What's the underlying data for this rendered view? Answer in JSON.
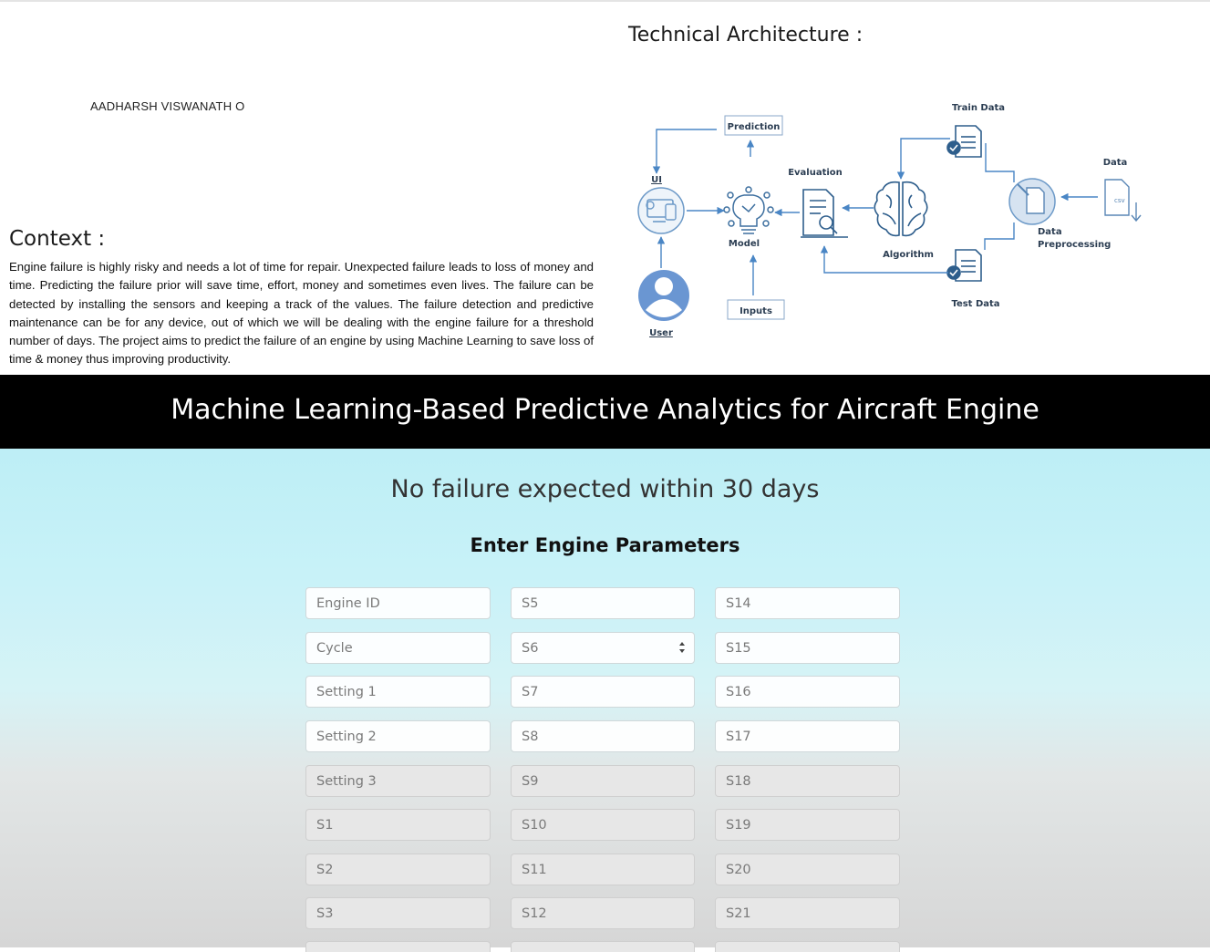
{
  "slide": {
    "author": "AADHARSH VISWANATH O",
    "context_title": "Context :",
    "context_body": "Engine failure is highly risky and needs a lot of time for repair. Unexpected failure leads to loss of money and time. Predicting the failure prior will save time, effort, money and sometimes even lives. The failure can be detected by installing the sensors and keeping a track of the values. The failure detection and predictive maintenance can be for any device, out of which we will be dealing with the engine failure for a threshold number of days. The project aims to predict the failure of an engine by using Machine Learning to save loss of time & money thus improving productivity.",
    "architecture_title": "Technical Architecture :",
    "diagram": {
      "prediction": "Prediction",
      "ui": "UI",
      "model": "Model",
      "evaluation": "Evaluation",
      "algorithm": "Algorithm",
      "train_data": "Train Data",
      "test_data": "Test Data",
      "data": "Data",
      "csv": "csv",
      "data_preprocessing_1": "Data",
      "data_preprocessing_2": "Preprocessing",
      "inputs": "Inputs",
      "user": "User"
    }
  },
  "app": {
    "header": "Machine Learning-Based Predictive Analytics for Aircraft Engine",
    "result": "No failure expected within 30 days",
    "form_title": "Enter Engine Parameters",
    "fields": [
      [
        "Engine ID",
        "S5",
        "S14"
      ],
      [
        "Cycle",
        "S6",
        "S15"
      ],
      [
        "Setting 1",
        "S7",
        "S16"
      ],
      [
        "Setting 2",
        "S8",
        "S17"
      ],
      [
        "Setting 3",
        "S9",
        "S18"
      ],
      [
        "S1",
        "S10",
        "S19"
      ],
      [
        "S2",
        "S11",
        "S20"
      ],
      [
        "S3",
        "S12",
        "S21"
      ]
    ]
  }
}
